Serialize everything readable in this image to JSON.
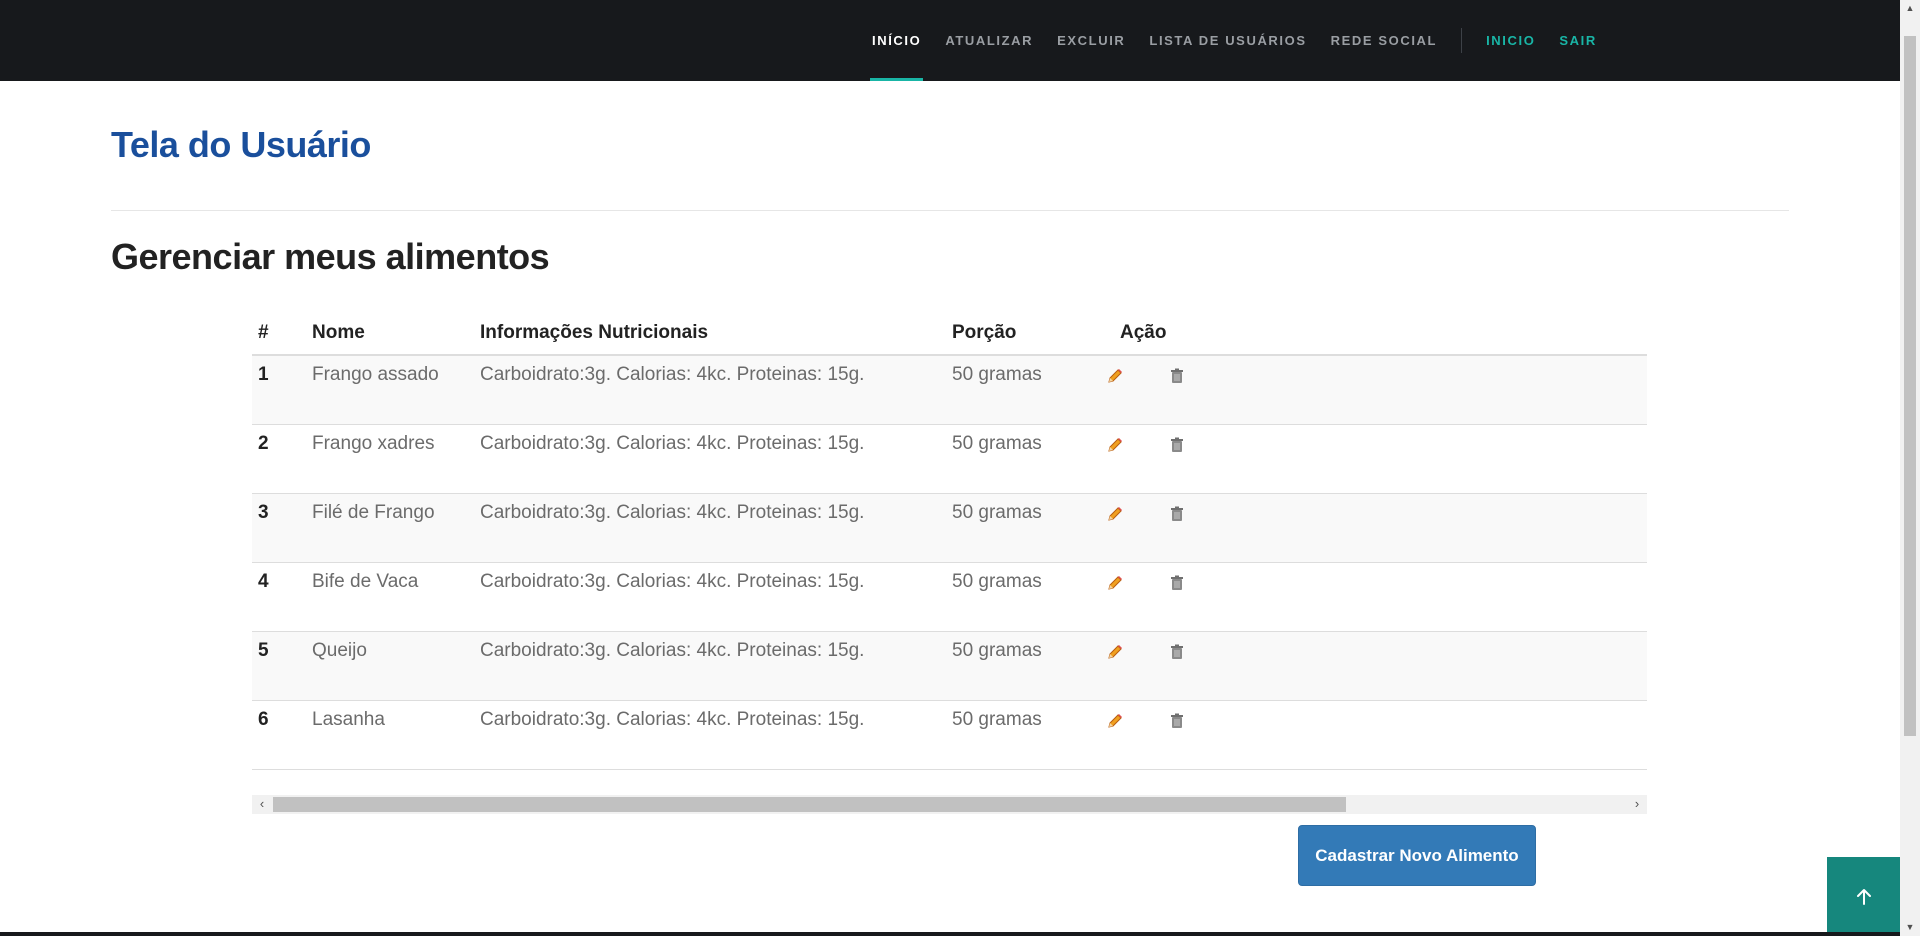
{
  "nav": {
    "items": [
      {
        "label": "INÍCIO"
      },
      {
        "label": "ATUALIZAR"
      },
      {
        "label": "EXCLUIR"
      },
      {
        "label": "LISTA DE USUÁRIOS"
      },
      {
        "label": "REDE SOCIAL"
      }
    ],
    "right": [
      {
        "label": "INICIO"
      },
      {
        "label": "SAIR"
      }
    ],
    "active_index": 0,
    "accent_color": "#19b5a6"
  },
  "page": {
    "title": "Tela do Usuário",
    "section_title": "Gerenciar meus alimentos"
  },
  "table": {
    "headers": {
      "num": "#",
      "name": "Nome",
      "info": "Informações Nutricionais",
      "portion": "Porção",
      "action": "Ação"
    },
    "rows": [
      {
        "num": "1",
        "name": "Frango assado",
        "info": "Carboidrato:3g. Calorias: 4kc. Proteinas: 15g.",
        "portion": "50 gramas"
      },
      {
        "num": "2",
        "name": "Frango xadres",
        "info": "Carboidrato:3g. Calorias: 4kc. Proteinas: 15g.",
        "portion": "50 gramas"
      },
      {
        "num": "3",
        "name": "Filé de Frango",
        "info": "Carboidrato:3g. Calorias: 4kc. Proteinas: 15g.",
        "portion": "50 gramas"
      },
      {
        "num": "4",
        "name": "Bife de Vaca",
        "info": "Carboidrato:3g. Calorias: 4kc. Proteinas: 15g.",
        "portion": "50 gramas"
      },
      {
        "num": "5",
        "name": "Queijo",
        "info": "Carboidrato:3g. Calorias: 4kc. Proteinas: 15g.",
        "portion": "50 gramas"
      },
      {
        "num": "6",
        "name": "Lasanha",
        "info": "Carboidrato:3g. Calorias: 4kc. Proteinas: 15g.",
        "portion": "50 gramas"
      }
    ],
    "action_icons": [
      "pencil-icon",
      "trash-icon"
    ]
  },
  "buttons": {
    "new_food": "Cadastrar Novo Alimento",
    "back_to_top_icon": "arrow-up-icon"
  },
  "colors": {
    "navbar": "#17191c",
    "title": "#1a4f9c",
    "primary_button": "#337ab7",
    "back_to_top": "#16877d"
  }
}
